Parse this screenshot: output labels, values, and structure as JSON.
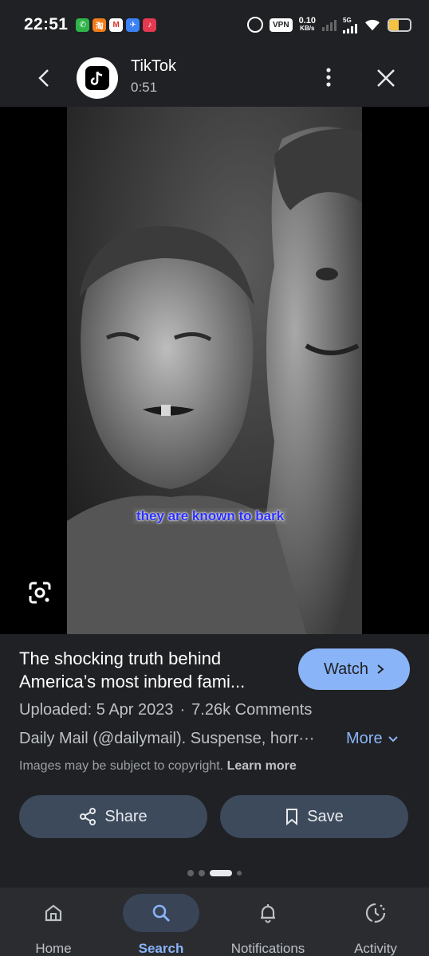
{
  "status_bar": {
    "time": "22:51",
    "vpn": "VPN",
    "speed_value": "0.10",
    "speed_unit": "KB/s",
    "network": "5G",
    "app_icons": [
      "wechat-icon",
      "taobao-icon",
      "gmail-icon",
      "feishu-icon",
      "tiktok-icon"
    ]
  },
  "header": {
    "source_name": "TikTok",
    "duration": "0:51"
  },
  "video": {
    "caption": "they are known to bark"
  },
  "result": {
    "title": "The shocking truth behind America’s most inbred fami...",
    "watch_label": "Watch",
    "uploaded": "Uploaded: 5 Apr 2023",
    "dot": "·",
    "comments": "7.26k Comments",
    "description": "Daily Mail (@dailymail). Suspense, horr···",
    "more_label": "More",
    "copyright": "Images may be subject to copyright.",
    "learn_more": "Learn more",
    "share_label": "Share",
    "save_label": "Save"
  },
  "pager": {
    "active_index": 2,
    "count": 4
  },
  "nav": {
    "items": [
      {
        "label": "Home",
        "icon": "home-icon"
      },
      {
        "label": "Search",
        "icon": "search-icon"
      },
      {
        "label": "Notifications",
        "icon": "bell-icon"
      },
      {
        "label": "Activity",
        "icon": "history-icon"
      }
    ],
    "active": "Search"
  },
  "colors": {
    "background": "#202124",
    "accent": "#8ab4f8",
    "button_bg": "#3c4a5c",
    "caption_text": "#2a2fff"
  }
}
